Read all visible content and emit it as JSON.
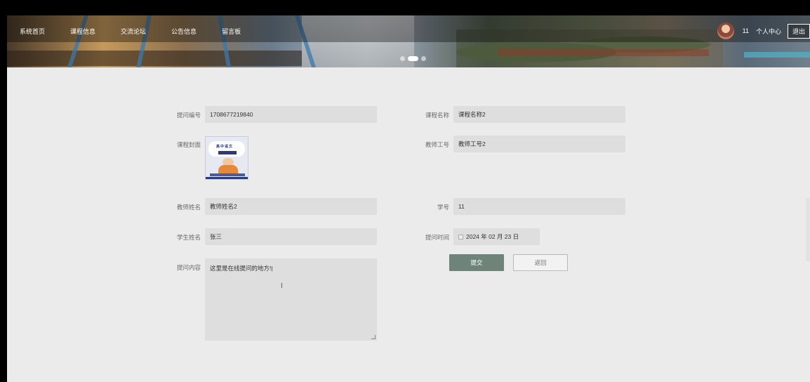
{
  "nav": {
    "items": [
      "系统首页",
      "课程信息",
      "交流论坛",
      "公告信息",
      "留言板"
    ]
  },
  "user": {
    "name": "11",
    "profile_link": "个人中心",
    "logout": "退出"
  },
  "carousel": {
    "slide_count": 3,
    "active_index": 1
  },
  "form": {
    "question_no": {
      "label": "提问编号",
      "value": "1708677219840"
    },
    "course_name": {
      "label": "课程名称",
      "value": "课程名称2"
    },
    "course_cover": {
      "label": "课程封面",
      "image_text": "高中语文"
    },
    "teacher_id": {
      "label": "教师工号",
      "value": "教师工号2"
    },
    "teacher_name": {
      "label": "教师姓名",
      "value": "教师姓名2"
    },
    "student_id": {
      "label": "学号",
      "value": "11"
    },
    "student_name": {
      "label": "学生姓名",
      "value": "张三"
    },
    "question_time": {
      "label": "提问时间",
      "value": "2024 年 02 月 23 日"
    },
    "question_content": {
      "label": "提问内容",
      "value": "这里是在线提问的地方!|"
    }
  },
  "buttons": {
    "submit": "提交",
    "back": "返回"
  },
  "colors": {
    "submit_bg": "#6f8479",
    "page_bg": "#ebebeb",
    "field_bg": "#dedede"
  }
}
